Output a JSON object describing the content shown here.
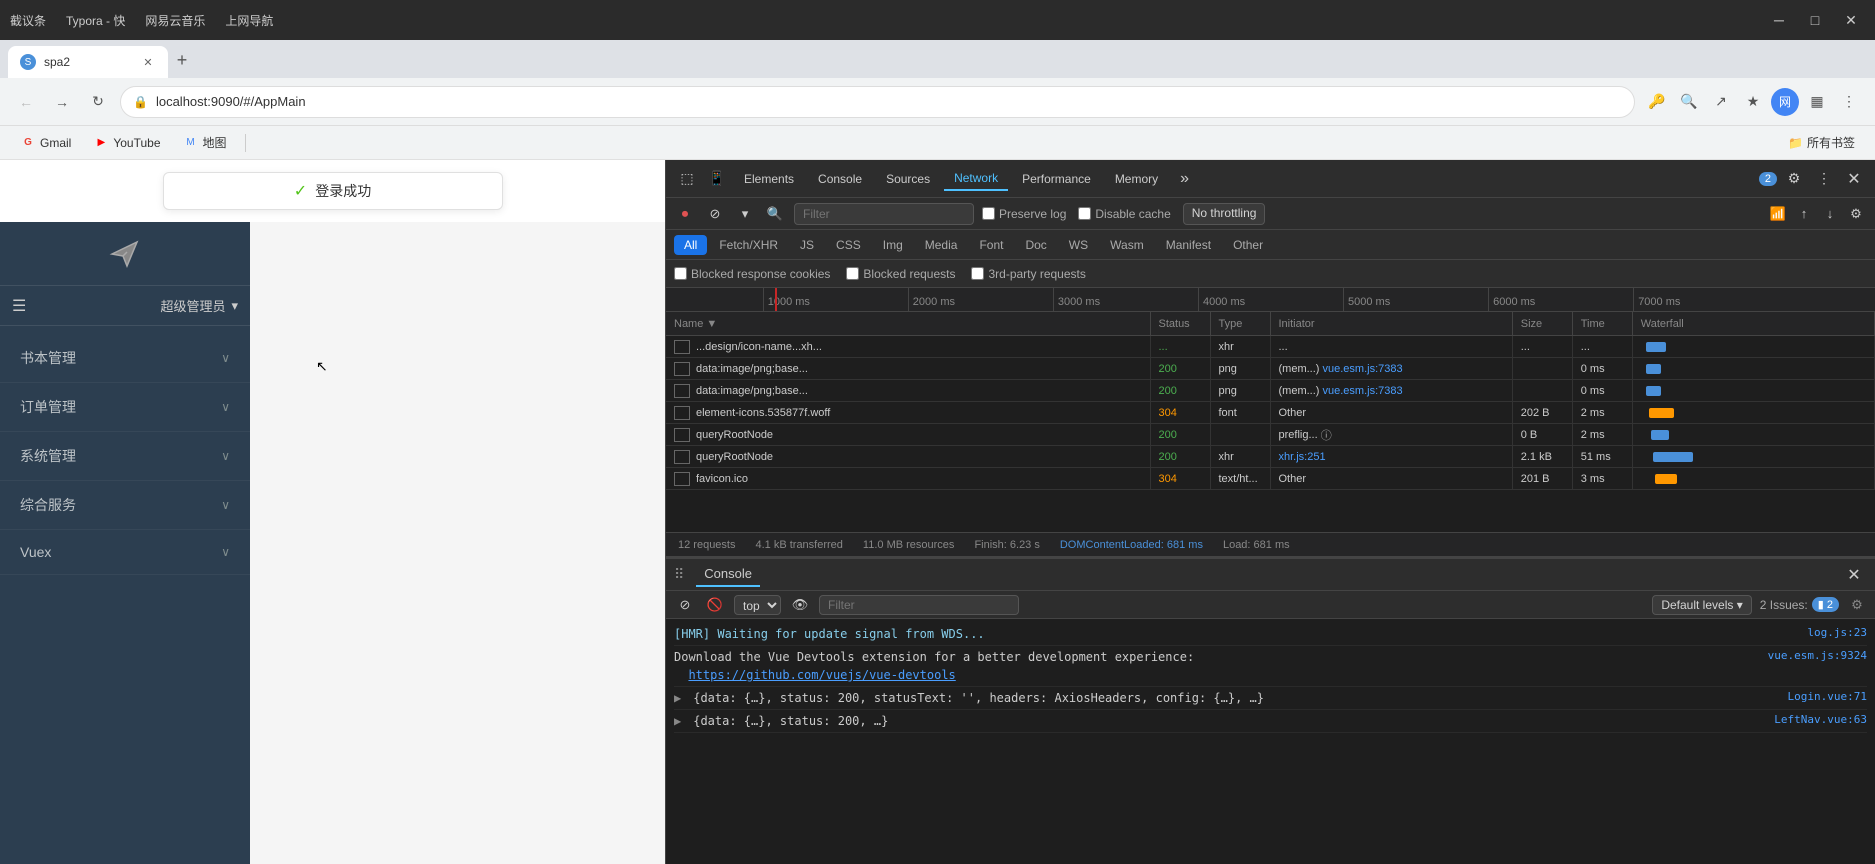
{
  "titlebar": {
    "apps": [
      "截议条",
      "Typora - 快",
      "网易云音乐",
      "上网导航"
    ],
    "window_title": "spa2",
    "controls": {
      "minimize": "─",
      "maximize": "□",
      "close": "✕"
    }
  },
  "browser": {
    "tab": {
      "title": "spa2",
      "favicon": "S"
    },
    "url": "localhost:9090/#/AppMain",
    "bookmarks": [
      {
        "name": "Gmail",
        "color": "#ea4335",
        "symbol": "G"
      },
      {
        "name": "YouTube",
        "color": "#ff0000",
        "symbol": "▶"
      },
      {
        "name": "地图",
        "color": "#4285f4",
        "symbol": "M"
      }
    ],
    "bookmark_folder": "所有书签"
  },
  "devtools": {
    "tabs": [
      "Elements",
      "Console",
      "Sources",
      "Network",
      "Performance",
      "Memory",
      "»"
    ],
    "active_tab": "Network",
    "badge": "2",
    "toolbar": {
      "record": "⏺",
      "stop": "⊘",
      "filter": "▾",
      "search": "🔍"
    },
    "network": {
      "filter_placeholder": "Filter",
      "preserve_log": "Preserve log",
      "disable_cache": "Disable cache",
      "throttle": "No throttling",
      "filter_tabs": [
        "All",
        "Fetch/XHR",
        "JS",
        "CSS",
        "Img",
        "Media",
        "Font",
        "Doc",
        "WS",
        "Wasm",
        "Manifest",
        "Other"
      ],
      "active_filter": "All",
      "checkboxes": [
        "Blocked response cookies",
        "Blocked requests",
        "3rd-party requests"
      ],
      "timeline": {
        "ticks": [
          "1000 ms",
          "2000 ms",
          "3000 ms",
          "4000 ms",
          "5000 ms",
          "6000 ms",
          "7000 ms"
        ]
      },
      "table_headers": [
        "Name",
        "Status",
        "Type",
        "Initiator",
        "Size",
        "Time",
        "Waterfall"
      ],
      "rows": [
        {
          "name": "...design/icon-name...xh...",
          "status": "...",
          "type": "xhr",
          "initiator": "...",
          "size": "...",
          "time": "...",
          "waterfall_w": 20
        },
        {
          "name": "data:image/png;base...",
          "status": "200",
          "type": "png",
          "initiator": "vue.esm.js:7383",
          "initiator_type": "(mem...)",
          "size": "",
          "time": "0 ms",
          "waterfall_w": 15
        },
        {
          "name": "data:image/png;base...",
          "status": "200",
          "type": "png",
          "initiator": "vue.esm.js:7383",
          "initiator_type": "(mem...)",
          "size": "",
          "time": "0 ms",
          "waterfall_w": 15
        },
        {
          "name": "element-icons.535877f.woff",
          "status": "304",
          "type": "font",
          "initiator": "Other",
          "initiator_type": "",
          "size": "202 B",
          "time": "2 ms",
          "waterfall_w": 25,
          "waterfall_color": "#ff9800"
        },
        {
          "name": "queryRootNode",
          "status": "200",
          "type": "",
          "initiator": "Preflight ⓘ",
          "initiator_type": "preflig...",
          "size": "0 B",
          "time": "2 ms",
          "waterfall_w": 18
        },
        {
          "name": "queryRootNode",
          "status": "200",
          "type": "xhr",
          "initiator": "xhr.js:251",
          "initiator_type": "",
          "size": "2.1 kB",
          "time": "51 ms",
          "waterfall_w": 40
        },
        {
          "name": "favicon.ico",
          "status": "304",
          "type": "text/ht...",
          "initiator": "Other",
          "initiator_type": "",
          "size": "201 B",
          "time": "3 ms",
          "waterfall_w": 22,
          "waterfall_color": "#ff9800"
        }
      ],
      "status_bar": {
        "requests": "12 requests",
        "transferred": "4.1 kB transferred",
        "resources": "11.0 MB resources",
        "finish": "Finish: 6.23 s",
        "domcontentloaded": "DOMContentLoaded: 681 ms",
        "load": "Load: 681 ms"
      }
    },
    "console": {
      "tab_label": "Console",
      "top_selector": "top",
      "filter_placeholder": "Filter",
      "default_levels": "Default levels ▾",
      "issues_label": "2 Issues:",
      "issues_badge": "▮ 2",
      "logs": [
        {
          "type": "hmr",
          "text": "[HMR] Waiting for update signal from WDS...",
          "source": "log.js:23"
        },
        {
          "type": "info",
          "text": "Download the Vue Devtools extension for a better development experience:\n  https://github.com/vuejs/vue-devtools",
          "link": "https://github.com/vuejs/vue-devtools",
          "source": "vue.esm.js:9324"
        },
        {
          "type": "expand",
          "text": "▶ {data: {…}, status: 200, statusText: '', headers: AxiosHeaders, config: {…}, …}",
          "source": "Login.vue:71"
        },
        {
          "type": "expand",
          "text": "▶ ...",
          "source": "LeftNav.vue:63"
        }
      ]
    }
  },
  "sidebar": {
    "menu_icon": "☰",
    "user": "超级管理员",
    "user_arrow": "▾",
    "menu_items": [
      {
        "label": "书本管理"
      },
      {
        "label": "订单管理"
      },
      {
        "label": "系统管理"
      },
      {
        "label": "综合服务"
      },
      {
        "label": "Vuex"
      }
    ]
  },
  "login_banner": {
    "icon": "✓",
    "text": "登录成功"
  }
}
